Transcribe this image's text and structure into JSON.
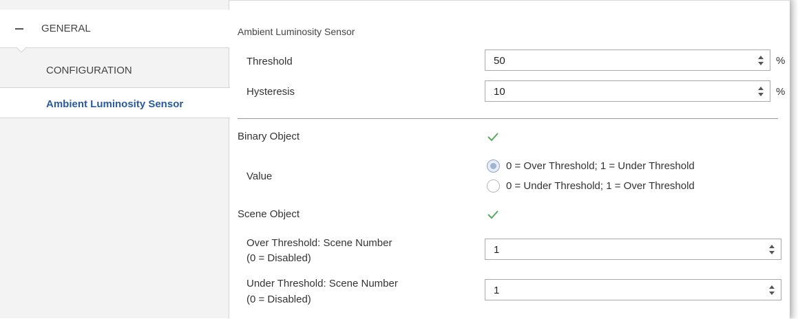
{
  "sidebar": {
    "general_label": "GENERAL",
    "items": [
      {
        "label": "CONFIGURATION"
      },
      {
        "label": "Ambient Luminosity Sensor"
      }
    ]
  },
  "main": {
    "section_title": "Ambient Luminosity Sensor",
    "threshold": {
      "label": "Threshold",
      "value": "50",
      "unit": "%"
    },
    "hysteresis": {
      "label": "Hysteresis",
      "value": "10",
      "unit": "%"
    },
    "binary_object": {
      "label": "Binary Object",
      "checked": true
    },
    "value": {
      "label": "Value",
      "options": [
        {
          "label": "0 = Over Threshold; 1 = Under Threshold",
          "selected": true
        },
        {
          "label": "0 = Under Threshold; 1 = Over Threshold",
          "selected": false
        }
      ]
    },
    "scene_object": {
      "label": "Scene Object",
      "checked": true
    },
    "over_scene": {
      "label_line1": "Over Threshold: Scene Number",
      "label_line2": "(0 = Disabled)",
      "value": "1"
    },
    "under_scene": {
      "label_line1": "Under Threshold: Scene Number",
      "label_line2": "(0 = Disabled)",
      "value": "1"
    }
  },
  "colors": {
    "accent": "#2a5a9c",
    "check": "#5aa85a"
  }
}
